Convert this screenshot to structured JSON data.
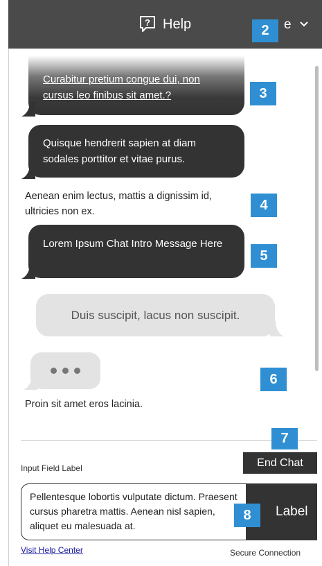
{
  "header": {
    "help_label": "Help",
    "right_text": "e",
    "help_icon": "help-question-icon",
    "dropdown_icon": "chevron-down-icon"
  },
  "badges": [
    "2",
    "3",
    "4",
    "5",
    "6",
    "7",
    "8"
  ],
  "messages": {
    "link_question": "Curabitur pretium congue dui, non cursus leo finibus sit amet.?",
    "agent_1": "Quisque hendrerit sapien at diam sodales porttitor et vitae purus.",
    "plain_1": "Aenean enim lectus, mattis a dignissim id, ultricies non ex.",
    "agent_2": "Lorem Ipsum Chat Intro Message Here",
    "user_1": "Duis suscipit, lacus non suscipit.",
    "plain_2": "Proin sit amet eros lacinia."
  },
  "footer": {
    "end_chat": "End Chat",
    "input_label": "Input Field Label",
    "input_value": "Pellentesque lobortis vulputate dictum. Praesent cursus pharetra mattis. Aenean nisl sapien, aliquet eu malesuada at.",
    "send_label": "Label",
    "visit_help": "Visit Help Center",
    "secure": "Secure Connection"
  },
  "colors": {
    "header_bg": "#4a4a4a",
    "bubble_dark": "#333333",
    "bubble_light": "#e3e3e3",
    "badge": "#2f8fd2"
  }
}
